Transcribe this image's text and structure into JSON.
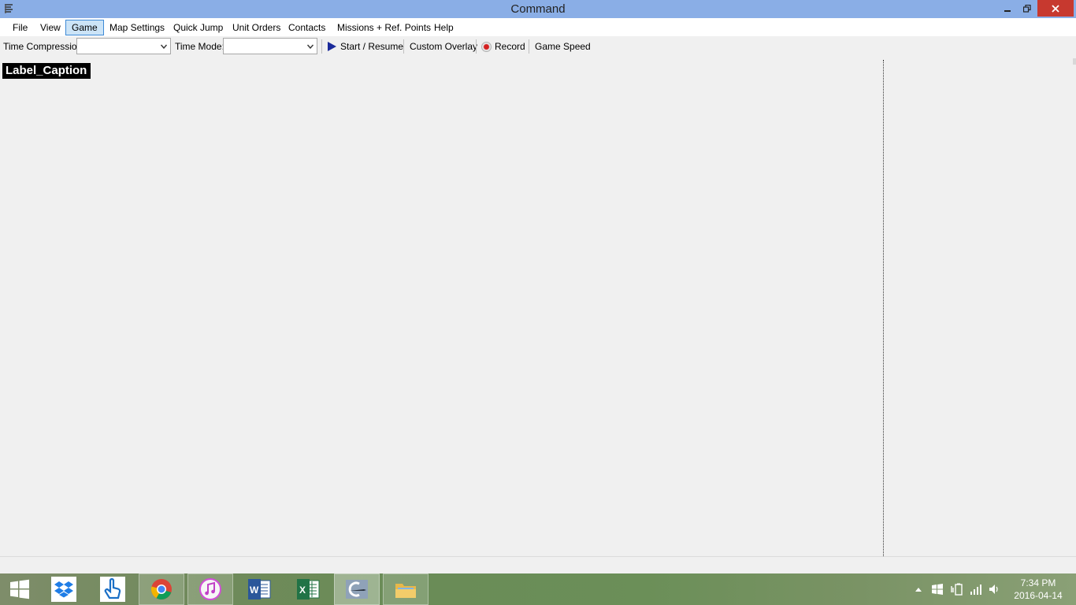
{
  "window": {
    "title": "Command"
  },
  "menu": {
    "items": [
      {
        "label": "File"
      },
      {
        "label": "View"
      },
      {
        "label": "Game",
        "active": true
      },
      {
        "label": "Map Settings"
      },
      {
        "label": "Quick Jump"
      },
      {
        "label": "Unit Orders"
      },
      {
        "label": "Contacts"
      },
      {
        "label": "Missions + Ref. Points"
      },
      {
        "label": "Help"
      }
    ]
  },
  "toolbar": {
    "time_compression_label": "Time Compression:",
    "time_compression_value": "",
    "time_mode_label": "Time Mode:",
    "time_mode_value": "",
    "start_resume_label": "Start / Resume",
    "custom_overlay_label": "Custom Overlay",
    "record_label": "Record",
    "game_speed_label": "Game Speed"
  },
  "main": {
    "caption": "Label_Caption"
  },
  "taskbar": {
    "apps": [
      "start-icon",
      "dropbox-icon",
      "touch-app-icon",
      "chrome-icon",
      "itunes-icon",
      "word-icon",
      "excel-icon",
      "command-app-icon",
      "file-explorer-icon"
    ],
    "clock": {
      "time": "7:34 PM",
      "date": "2016-04-14"
    }
  },
  "colors": {
    "titlebar": "#8aaee6",
    "close_button": "#c7392f",
    "menu_active_bg": "#cce4f7",
    "menu_active_border": "#3e8ad6",
    "caption_bg": "#000000",
    "play_icon": "#1a2a9a"
  }
}
